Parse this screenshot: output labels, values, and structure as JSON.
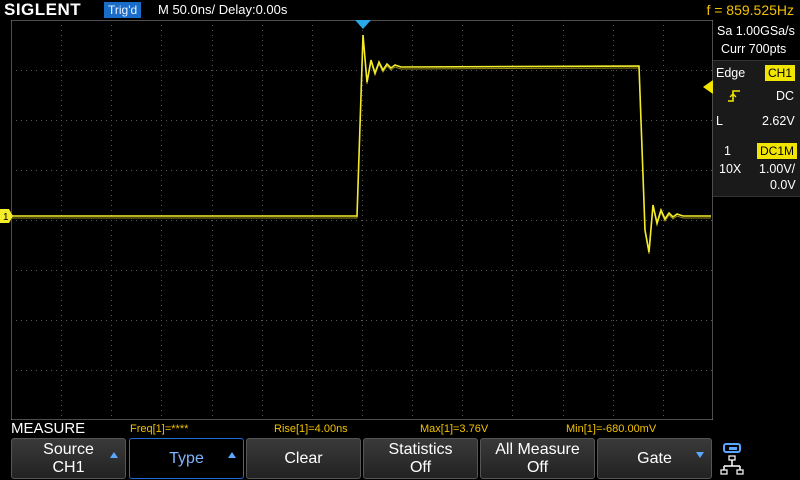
{
  "header": {
    "brand": "SIGLENT",
    "trigger_status": "Trig'd",
    "timebase": "M 50.0ns/",
    "delay": "Delay:0.00s",
    "frequency": "f = 859.525Hz"
  },
  "acquisition": {
    "sample_rate": "Sa 1.00GSa/s",
    "memory": "Curr 700pts"
  },
  "trigger": {
    "type": "Edge",
    "source": "CH1",
    "coupling": "DC",
    "level_label": "L",
    "level": "2.62V"
  },
  "channel": {
    "number": "1",
    "coupling": "DC1M",
    "probe": "10X",
    "scale": "1.00V/",
    "offset": "0.0V",
    "marker_label": "1"
  },
  "measure": {
    "title": "MEASURE",
    "items": [
      "Freq[1]=****",
      "Rise[1]=4.00ns",
      "Max[1]=3.76V",
      "Min[1]=-680.00mV"
    ]
  },
  "softkeys": [
    {
      "line1": "Source",
      "line2": "CH1",
      "arrow": "up"
    },
    {
      "line1": "Type",
      "arrow": "up",
      "active": true
    },
    {
      "line1": "Clear"
    },
    {
      "line1": "Statistics",
      "line2": "Off"
    },
    {
      "line1": "All Measure",
      "line2": "Off"
    },
    {
      "line1": "Gate",
      "arrow": "down"
    }
  ],
  "colors": {
    "trace": "#f5ec2a",
    "accent_blue": "#1a6cc9",
    "freq_text": "#f2c200"
  }
}
